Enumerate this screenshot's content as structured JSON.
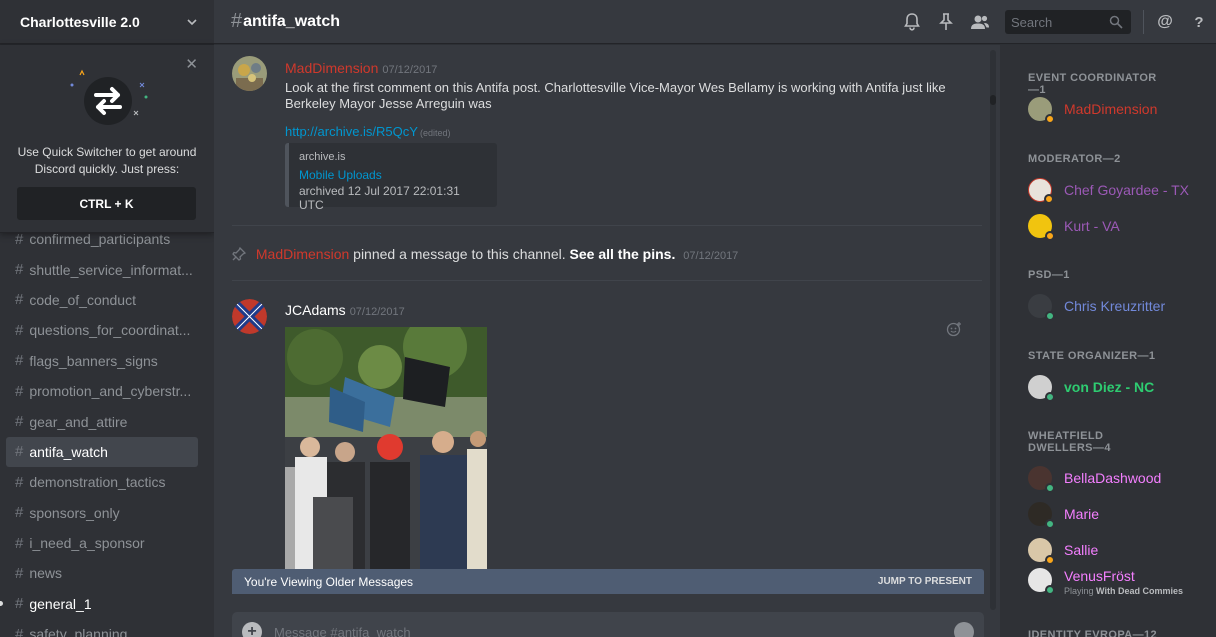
{
  "server": {
    "name": "Charlottesville 2.0"
  },
  "quick_switcher": {
    "text": "Use Quick Switcher to get around Discord quickly. Just press:",
    "shortcut": "CTRL + K"
  },
  "channels": [
    {
      "name": "confirmed_participants",
      "state": "partial"
    },
    {
      "name": "shuttle_service_informat...",
      "state": "normal"
    },
    {
      "name": "code_of_conduct",
      "state": "normal"
    },
    {
      "name": "questions_for_coordinat...",
      "state": "normal"
    },
    {
      "name": "flags_banners_signs",
      "state": "normal"
    },
    {
      "name": "promotion_and_cyberstr...",
      "state": "normal"
    },
    {
      "name": "gear_and_attire",
      "state": "normal"
    },
    {
      "name": "antifa_watch",
      "state": "active"
    },
    {
      "name": "demonstration_tactics",
      "state": "normal"
    },
    {
      "name": "sponsors_only",
      "state": "normal"
    },
    {
      "name": "i_need_a_sponsor",
      "state": "normal"
    },
    {
      "name": "news",
      "state": "normal"
    },
    {
      "name": "general_1",
      "state": "unread"
    },
    {
      "name": "safety_planning",
      "state": "partial"
    }
  ],
  "header": {
    "hash": "#",
    "channel": "antifa_watch",
    "search_placeholder": "Search",
    "icons": [
      "bell-icon",
      "pin-icon",
      "members-icon",
      "at-icon",
      "help-icon"
    ]
  },
  "messages": {
    "msg1": {
      "author": "MadDimension",
      "author_color": "#d0392c",
      "timestamp": "07/12/2017",
      "text": "Look at the first comment on this Antifa post. Charlottesville Vice-Mayor Wes Bellamy is working with Antifa just like Berkeley Mayor Jesse Arreguin was",
      "link": "http://archive.is/R5QcY",
      "edited": "(edited)",
      "embed": {
        "provider": "archive.is",
        "title": "Mobile Uploads",
        "description": "archived 12 Jul 2017 22:01:31 UTC"
      }
    },
    "system": {
      "author": "MadDimension",
      "text": "pinned a message to this channel.",
      "link": "See all the pins.",
      "timestamp": "07/12/2017"
    },
    "msg2": {
      "author": "JCAdams",
      "author_color": "#ffffff",
      "timestamp": "07/12/2017"
    }
  },
  "older_bar": {
    "text": "You're Viewing Older Messages",
    "jump": "JUMP TO PRESENT"
  },
  "composer": {
    "placeholder": "Message #antifa_watch"
  },
  "members": {
    "groups": [
      {
        "title": "EVENT COORDINATOR—1"
      },
      {
        "title": "MODERATOR—2"
      },
      {
        "title": "PSD—1"
      },
      {
        "title": "STATE ORGANIZER—1"
      },
      {
        "title": "WHEATFIELD DWELLERS—4"
      },
      {
        "title": "IDENTITY EVROPA—12"
      }
    ],
    "list": [
      {
        "name": "MadDimension",
        "color": "#d0392c",
        "status": "#faa61a"
      },
      {
        "name": "Chef Goyardee - TX",
        "color": "#9b59b6",
        "status": "#faa61a"
      },
      {
        "name": "Kurt - VA",
        "color": "#9b59b6",
        "status": "#faa61a"
      },
      {
        "name": "Chris Kreuzritter",
        "color": "#7289da",
        "status": "#43b581"
      },
      {
        "name": "von Diez - NC",
        "color": "#2ecc71",
        "status": "#43b581"
      },
      {
        "name": "BellaDashwood",
        "color": "#f47fff",
        "status": "#43b581"
      },
      {
        "name": "Marie",
        "color": "#f47fff",
        "status": "#43b581"
      },
      {
        "name": "Sallie",
        "color": "#f47fff",
        "status": "#faa61a"
      },
      {
        "name": "VenusFröst",
        "color": "#f47fff",
        "status": "#43b581",
        "activity_prefix": "Playing",
        "activity": "With Dead Commies"
      }
    ]
  }
}
